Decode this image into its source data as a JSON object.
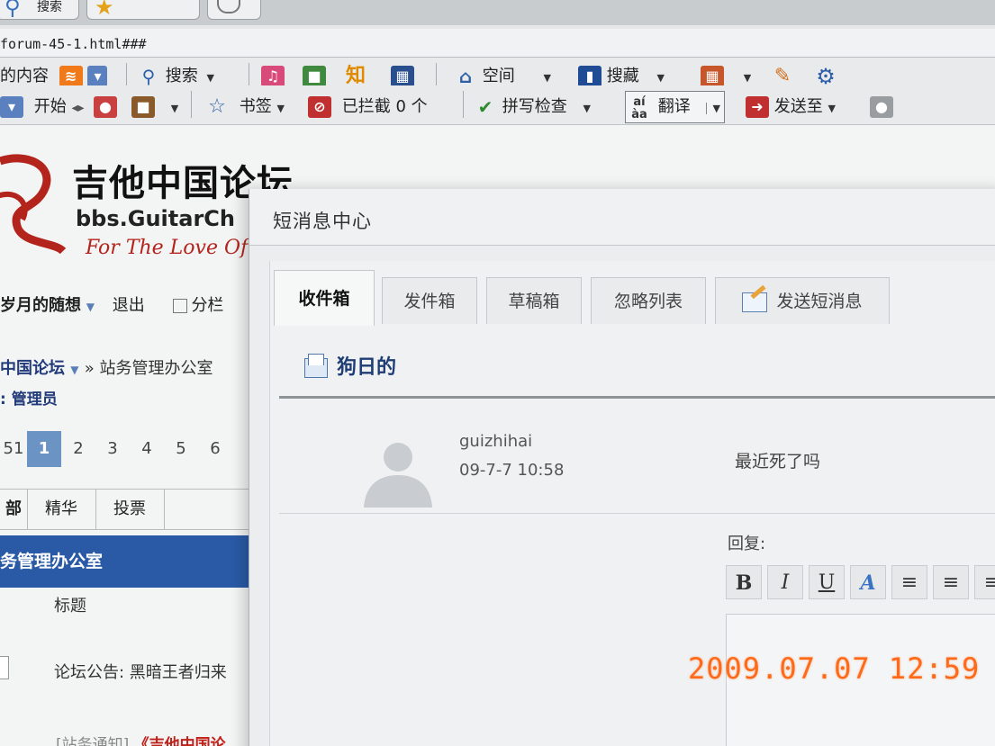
{
  "browser": {
    "tabs": [
      {
        "label": "搜索",
        "icon": "search-icon"
      },
      {
        "label": "",
        "icon": "star-icon"
      }
    ],
    "address": "forum-45-1.html###",
    "toolbar1": {
      "content_label": "的内容",
      "search_label": "搜索",
      "zhi_label": "知",
      "space_label": "空间",
      "favorites_label": "搜藏"
    },
    "toolbar2": {
      "start_label": "开始",
      "bookmarks_label": "书签",
      "blocked_label": "已拦截 0 个",
      "spellcheck_label": "拼写检查",
      "translate_label": "翻译",
      "sendto_label": "发送至"
    }
  },
  "forum": {
    "logo_title": "吉他中国论坛",
    "logo_sub": "bbs.GuitarCh",
    "logo_tag": "For The Love Of",
    "user_name": "岁月的随想",
    "logout": "退出",
    "layout_option": "分栏",
    "breadcrumb_home": "中国论坛",
    "breadcrumb_rest": "» 站务管理办公室",
    "moderator": ": 管理员",
    "pages": [
      "51",
      "1",
      "2",
      "3",
      "4",
      "5",
      "6"
    ],
    "current_page": "1",
    "filters": [
      "部",
      "精华",
      "投票"
    ],
    "board_name": "务管理办公室",
    "col_title": "标题",
    "announcement": "论坛公告: 黑暗王者归来",
    "notice_prefix": "[站务通知]",
    "notice_title": "《吉他中国论"
  },
  "pm": {
    "title": "短消息中心",
    "tabs": [
      {
        "label": "收件箱",
        "active": true
      },
      {
        "label": "发件箱",
        "active": false
      },
      {
        "label": "草稿箱",
        "active": false
      },
      {
        "label": "忽略列表",
        "active": false
      },
      {
        "label": "发送短消息",
        "active": false
      }
    ],
    "subject": "狗日的",
    "message": {
      "sender": "guizhihai",
      "time": "09-7-7 10:58",
      "text": "最近死了吗"
    },
    "reply_label": "回复:",
    "editor_buttons": [
      "B",
      "I",
      "U",
      "A",
      "≡",
      "≡",
      "≡"
    ]
  },
  "photo_timestamp": "2009.07.07  12:59",
  "colors": {
    "forum_blue": "#2a5aa6",
    "current_page": "#6b94c4",
    "timestamp_orange": "#ff6a1a"
  }
}
